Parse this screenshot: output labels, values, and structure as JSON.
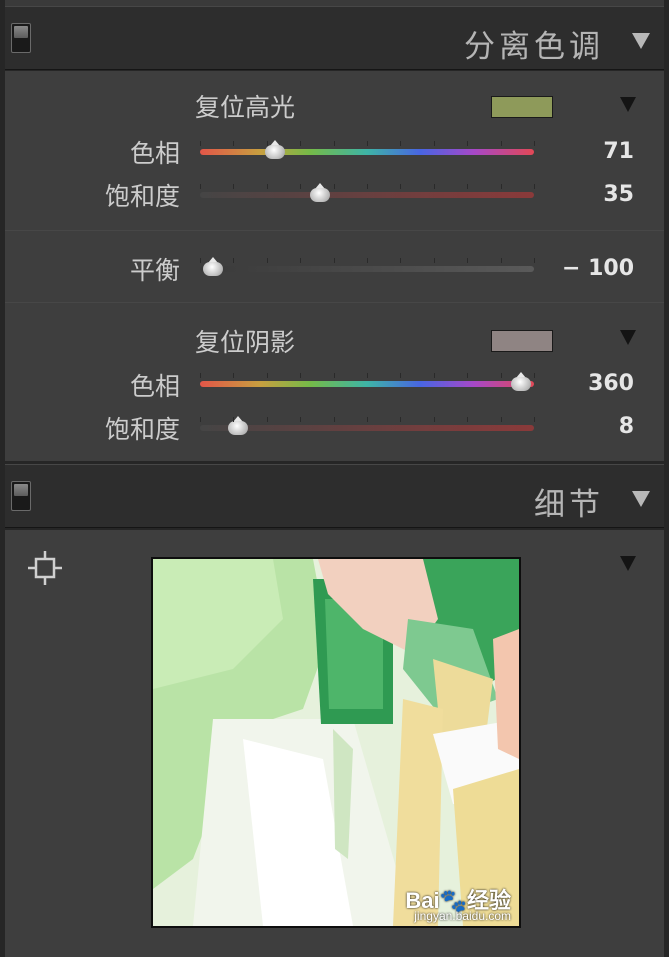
{
  "split_toning": {
    "header_title": "分离色调",
    "highlights": {
      "reset_label": "复位高光",
      "swatch_color": "#8e9a5a",
      "hue_label": "色相",
      "hue_value": "71",
      "hue_level": 71,
      "saturation_label": "饱和度",
      "saturation_value": "35",
      "saturation_level": 35
    },
    "balance": {
      "label": "平衡",
      "value": "− 100",
      "level": -100
    },
    "shadows": {
      "reset_label": "复位阴影",
      "swatch_color": "#8f8483",
      "hue_label": "色相",
      "hue_value": "360",
      "hue_level": 360,
      "saturation_label": "饱和度",
      "saturation_value": "8",
      "saturation_level": 8
    }
  },
  "detail": {
    "header_title": "细节"
  },
  "icons": {
    "panel_toggle": "panel-toggle-icon",
    "collapse": "triangle-down-icon",
    "target": "crosshair-target-icon"
  },
  "watermark": {
    "brand": "Bai",
    "brand_suffix": "经验",
    "url": "jingyan.baidu.com"
  }
}
